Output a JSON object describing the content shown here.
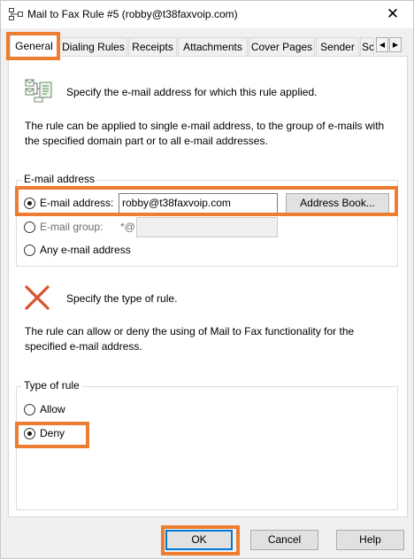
{
  "window": {
    "title": "Mail to Fax Rule #5 (robby@t38faxvoip.com)",
    "close_glyph": "✕"
  },
  "tabs": [
    {
      "label": "General"
    },
    {
      "label": "Dialing Rules"
    },
    {
      "label": "Receipts"
    },
    {
      "label": "Attachments"
    },
    {
      "label": "Cover Pages"
    },
    {
      "label": "Sender"
    },
    {
      "label": "Sc"
    }
  ],
  "tab_scroll": {
    "left_glyph": "◀",
    "right_glyph": "▶"
  },
  "email_section": {
    "description": "Specify the e-mail address for which this rule applied.",
    "detail": "The rule can be applied to single e-mail address, to the group of e-mails with the specified domain part or to all e-mail addresses.",
    "group_title": "E-mail address",
    "option_email_label": "E-mail address:",
    "email_value": "robby@t38faxvoip.com",
    "address_book_label": "Address Book...",
    "option_group_label": "E-mail group:",
    "group_prefix": "*@",
    "group_value": "",
    "option_any_label": "Any e-mail address",
    "selected": "email"
  },
  "type_section": {
    "description": "Specify the type of rule.",
    "detail": "The rule can allow or deny the using of Mail to Fax functionality for the specified e-mail address.",
    "group_title": "Type of rule",
    "option_allow_label": "Allow",
    "option_deny_label": "Deny",
    "selected": "deny"
  },
  "buttons": {
    "ok": "OK",
    "cancel": "Cancel",
    "help": "Help"
  },
  "icons": {
    "title_icon": "network-icon",
    "email_icon": "email-rules-icon",
    "type_icon": "deny-x-icon"
  },
  "colors": {
    "highlight": "#ed7d31",
    "deny_icon": "#d9532c",
    "focus_border": "#0078d7"
  }
}
